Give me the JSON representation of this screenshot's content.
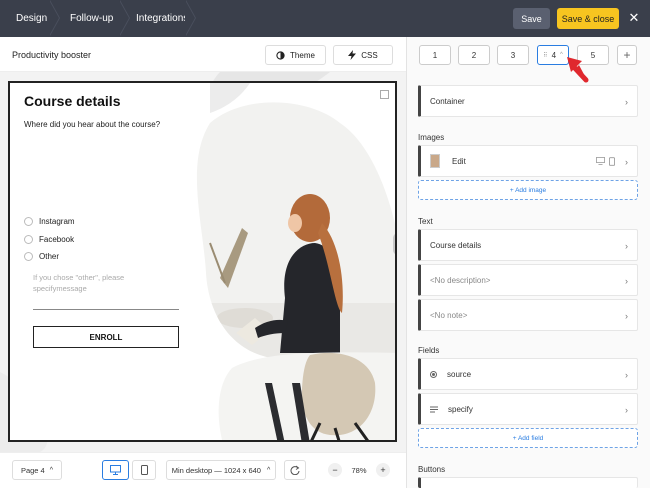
{
  "topbar": {
    "tabs": [
      "Design",
      "Follow-up",
      "Integrations"
    ],
    "save_label": "Save",
    "save_close_label": "Save & close",
    "close_symbol": "✕"
  },
  "left": {
    "doc_title": "Productivity booster",
    "theme_label": "Theme",
    "css_label": "CSS"
  },
  "popup": {
    "title": "Course details",
    "question": "Where did you hear about the course?",
    "options": [
      "Instagram",
      "Facebook",
      "Other"
    ],
    "hint": "If you chose \"other\", please specifymessage",
    "button_label": "ENROLL"
  },
  "bottom": {
    "page_select": "Page 4",
    "viewport_select": "Min desktop — 1024 x 640",
    "zoom": "78%",
    "minus": "−",
    "plus": "+"
  },
  "right": {
    "pages": [
      "1",
      "2",
      "3",
      "4",
      "5"
    ],
    "active_page": "4",
    "container_label": "Container",
    "images_heading": "Images",
    "image_edit_label": "Edit",
    "add_image_label": "+ Add image",
    "text_heading": "Text",
    "text_items": [
      "Course details",
      "<No description>",
      "<No note>"
    ],
    "fields_heading": "Fields",
    "field_items": [
      "source",
      "specify"
    ],
    "add_field_label": "+ Add field",
    "buttons_heading": "Buttons"
  },
  "colors": {
    "topbar": "#3a3f4b",
    "accent_yellow": "#f7c520",
    "accent_blue": "#2a7de1",
    "annotation_red": "#e0282e"
  },
  "icons": [
    "theme-contrast-icon",
    "lightning-icon",
    "desktop-icon",
    "mobile-icon",
    "rotate-icon",
    "chevron-right-icon",
    "plus-icon",
    "drag-handle-icon",
    "close-icon",
    "red-arrow-annotation"
  ]
}
